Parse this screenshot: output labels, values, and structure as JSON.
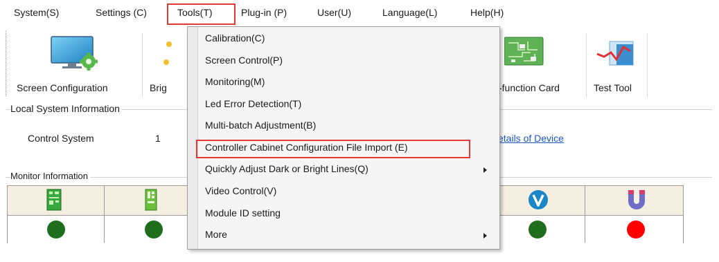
{
  "menubar": {
    "items": [
      "System(S)",
      "Settings (C)",
      "Tools(T)",
      "Plug-in (P)",
      "User(U)",
      "Language(L)",
      "Help(H)"
    ]
  },
  "toolbar": {
    "screen_configuration": "Screen Configuration",
    "brightness_partial": "Brig",
    "multifunction_card_partial": "-function Card",
    "test_tool": "Test Tool"
  },
  "local_system": {
    "title": "Local System Information",
    "control_system_label": "Control System",
    "control_system_value": "1",
    "details_link": "etails of Device"
  },
  "monitor": {
    "title": "Monitor Information",
    "status_colors": [
      "#1e6e1e",
      "#1e6e1e",
      "#1e6e1e",
      "#ff0000"
    ]
  },
  "tools_menu": {
    "items": [
      "Calibration(C)",
      "Screen Control(P)",
      "Monitoring(M)",
      "Led Error Detection(T)",
      "Multi-batch Adjustment(B)",
      "Controller Cabinet Configuration File Import (E)",
      "Quickly Adjust Dark or Bright Lines(Q)",
      "Video Control(V)",
      "Module ID setting",
      "More"
    ]
  },
  "colors": {
    "highlight_red": "#e53935",
    "status_green": "#1e6e1e",
    "status_red": "#ff0000",
    "link_blue": "#1a56c6"
  }
}
